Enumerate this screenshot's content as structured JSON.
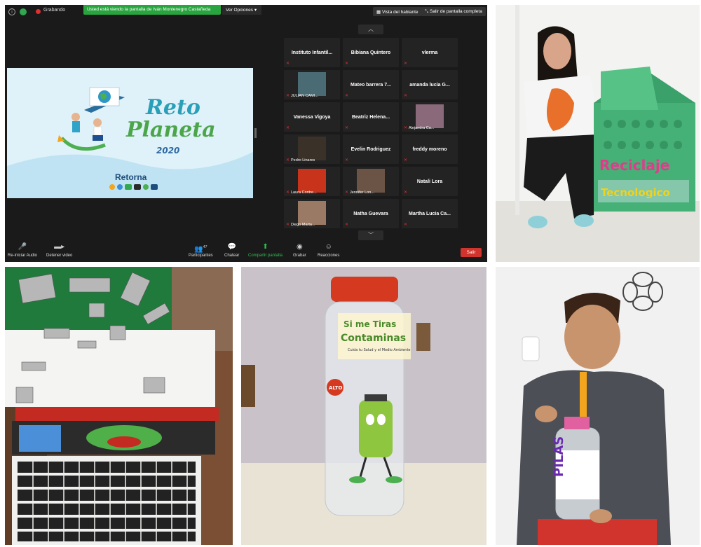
{
  "zoom": {
    "recording_label": "Grabando",
    "share_banner": "Usted está viendo la pantalla de Iván Montenegro Castañeda",
    "view_options": "Ver Opciones",
    "speaker_view": "Vista del hablante",
    "exit_fullscreen": "Salir de pantalla completa",
    "shared_screen": {
      "title_line1": "Reto",
      "title_line2": "Planeta",
      "year": "2020",
      "brand": "Retorna"
    },
    "tiles": [
      {
        "name": "Instituto Infantil...",
        "thumb": ""
      },
      {
        "name": "Bibiana Quintero",
        "thumb": ""
      },
      {
        "name": "vlerma",
        "thumb": ""
      },
      {
        "name": "",
        "caption": "JULIAN CAMI...",
        "thumb": "#4a6b73"
      },
      {
        "name": "Mateo barrera 7...",
        "thumb": ""
      },
      {
        "name": "amanda lucia G...",
        "thumb": ""
      },
      {
        "name": "Vanessa Vigoya",
        "thumb": ""
      },
      {
        "name": "Beatriz Helena...",
        "thumb": ""
      },
      {
        "name": "",
        "caption": "Alejandra Ca...",
        "thumb": "#8a6a7a"
      },
      {
        "name": "",
        "caption": "Pedro Linares",
        "thumb": "#3a3228"
      },
      {
        "name": "Evelin Rodriguez",
        "thumb": ""
      },
      {
        "name": "freddy moreno",
        "thumb": ""
      },
      {
        "name": "",
        "caption": "Laura Contre...",
        "thumb": "#c8331c"
      },
      {
        "name": "",
        "caption": "Jennifer Lon...",
        "thumb": "#6b5446"
      },
      {
        "name": "Natali Lora",
        "thumb": ""
      },
      {
        "name": "",
        "caption": "Diego Marta...",
        "thumb": "#9a7a64"
      },
      {
        "name": "Natha Guevara",
        "thumb": ""
      },
      {
        "name": "Martha Lucia Ca...",
        "thumb": ""
      }
    ],
    "controls": [
      {
        "label": "Re-iniciar Audio",
        "icon": "mic-muted-icon"
      },
      {
        "label": "Detener video",
        "icon": "video-icon"
      },
      {
        "label": "Participantes",
        "icon": "participants-icon",
        "count": "47"
      },
      {
        "label": "Chatear",
        "icon": "chat-icon"
      },
      {
        "label": "Compartir pantalla",
        "icon": "share-screen-icon"
      },
      {
        "label": "Grabar",
        "icon": "record-icon"
      },
      {
        "label": "Reacciones",
        "icon": "reactions-icon"
      }
    ],
    "exit_label": "Salir",
    "colors": {
      "background": "#1a1a1a",
      "share_green": "#29a53f",
      "exit_red": "#d0342c"
    }
  },
  "photos": {
    "girl": {
      "box_word1": "Reciclaje",
      "box_word2": "Tecnologico"
    },
    "jar": {
      "label_line1": "Si me Tiras",
      "label_line2": "Contaminas",
      "label_line3": "Cuida tu Salud y el Medio Ambiente",
      "sign": "ALTO"
    },
    "boy": {
      "bottle_label": "PILAS"
    }
  }
}
